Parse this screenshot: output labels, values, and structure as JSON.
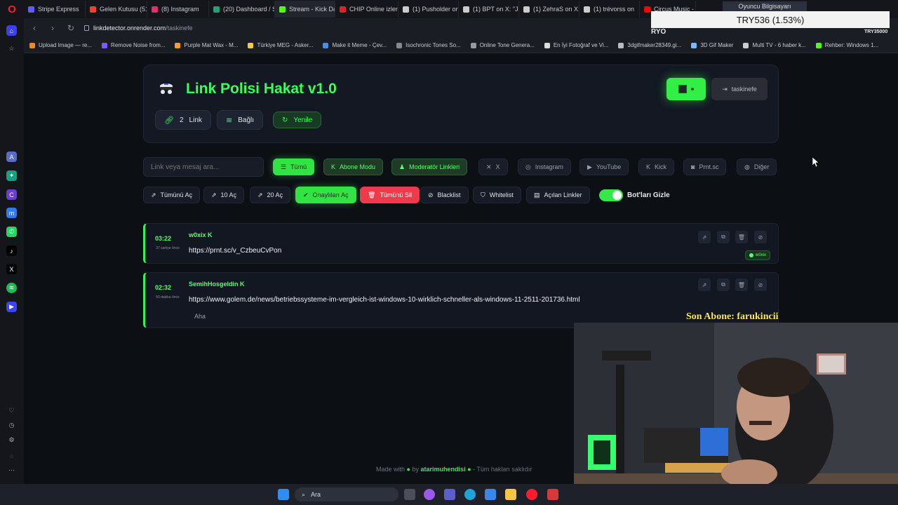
{
  "browser": {
    "tabs": [
      {
        "label": "Stripe Express",
        "color": "#635bff"
      },
      {
        "label": "Gelen Kutusu (516)",
        "color": "#ea4335"
      },
      {
        "label": "(8) Instagram",
        "color": "#e1306c"
      },
      {
        "label": "(20) Dashboard / S",
        "color": "#2b9e75"
      },
      {
        "label": "Stream - Kick Dash",
        "color": "#53fc18"
      },
      {
        "label": "CHIP Online izlene",
        "color": "#d7262a"
      },
      {
        "label": "(1) Pusholder on X",
        "color": "#cccccc"
      },
      {
        "label": "(1) BPT on X: \"Japo",
        "color": "#cccccc"
      },
      {
        "label": "(1) ZehraS on X: \"E",
        "color": "#cccccc"
      },
      {
        "label": "(1) trévorss on",
        "color": "#cccccc"
      },
      {
        "label": "Circus Music - You",
        "color": "#ff0000"
      }
    ],
    "url_host": "linkdetector.onrender.com",
    "url_path": "/taskinefe",
    "bookmarks": [
      {
        "label": "Upload Image — re...",
        "color": "#e98b2a"
      },
      {
        "label": "Remove Noise from...",
        "color": "#7b5cff"
      },
      {
        "label": "Purple Mat Wax - M...",
        "color": "#f0a020"
      },
      {
        "label": "Türkiye MEG - Asker...",
        "color": "#f2c94c"
      },
      {
        "label": "Make it Meme - Çev...",
        "color": "#4a90e2"
      },
      {
        "label": "Isochronic Tones So...",
        "color": "#888888"
      },
      {
        "label": "Online Tone Genera...",
        "color": "#999999"
      },
      {
        "label": "En İyi Fotoğraf ve Vi...",
        "color": "#dddddd"
      },
      {
        "label": "3dgifmaker28349.gi...",
        "color": "#bbbbbb"
      },
      {
        "label": "3D Gif Maker",
        "color": "#7ab8ff"
      },
      {
        "label": "Multi TV - 6 haber k...",
        "color": "#cccccc"
      },
      {
        "label": "Rehber: Windows 1...",
        "color": "#53fc18"
      }
    ]
  },
  "app": {
    "title": "Link Polisi Hakat v1.0",
    "link_count": "2",
    "link_label": "Link",
    "connection": "Bağlı",
    "refresh": "Yenile",
    "username": "taskinefe"
  },
  "filters": {
    "search_placeholder": "Link veya mesaj ara...",
    "all": "Tümü",
    "subscriber": "Abone Modu",
    "moderator": "Moderatör Linkleri",
    "x": "X",
    "instagram": "Instagram",
    "youtube": "YouTube",
    "kick": "Kick",
    "prntsc": "Prnt.sc",
    "other": "Diğer"
  },
  "actions": {
    "open_all": "Tümünü Aç",
    "open_10": "10 Aç",
    "open_20": "20 Aç",
    "open_approved": "Onaylıları Aç",
    "delete_all": "Tümünü Sil",
    "blacklist": "Blacklist",
    "whitelist": "Whitelist",
    "opened_links": "Açılan Linkler",
    "hide_bots": "Bot'ları Gizle",
    "hide_bots_on": true
  },
  "links": [
    {
      "time": "03:22",
      "ago": "37 saniye önce",
      "user": "w0xix",
      "url": "https://prnt.sc/v_CzbeuCvPon",
      "badge": "w0xix",
      "note": ""
    },
    {
      "time": "02:32",
      "ago": "50 dakika önce",
      "user": "SemihHosgeldin",
      "url": "https://www.golem.de/news/betriebssysteme-im-vergleich-ist-windows-10-wirklich-schneller-als-windows-11-2511-201736.html",
      "badge": "",
      "note": "Aha"
    }
  ],
  "footer": {
    "made_with": "Made with",
    "by": "by",
    "author": "atarimuhendisi",
    "rights": "- Tüm hakları saklıdır"
  },
  "overlay": {
    "top_label": "Oyuncu Bilgisayarı",
    "price": "TRY536 (1.53%)",
    "ryo": "RYO",
    "try_small": "TRY35000",
    "last_subscriber": "Son Abone: farukincii"
  },
  "taskbar": {
    "search_label": "Ara"
  }
}
